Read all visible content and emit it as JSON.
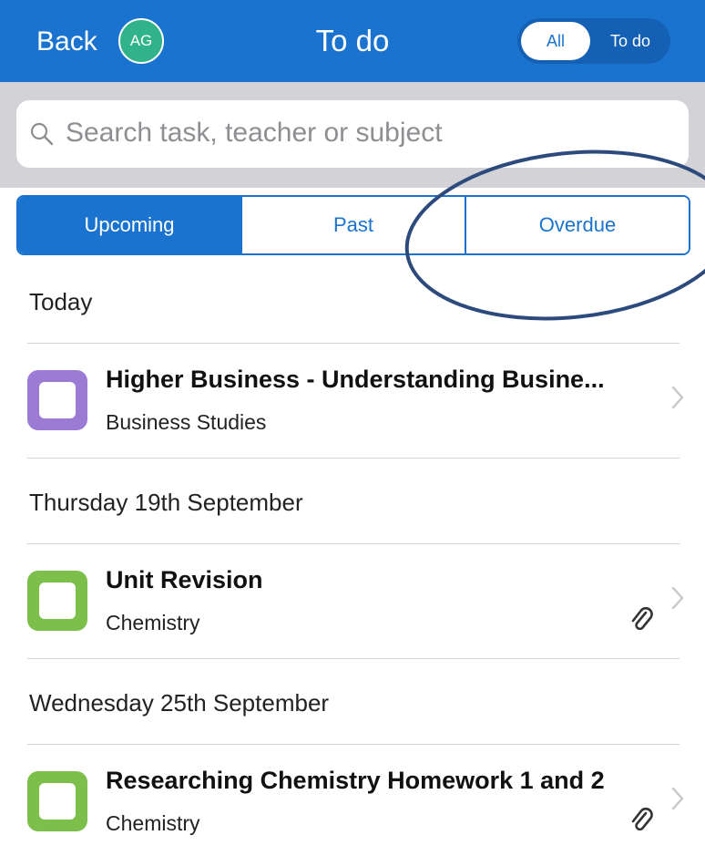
{
  "header": {
    "back_label": "Back",
    "avatar_initials": "AG",
    "title": "To do",
    "toggle": {
      "options": [
        "All",
        "To do"
      ],
      "selected": "All"
    }
  },
  "search": {
    "placeholder": "Search task, teacher or subject"
  },
  "filter_tabs": {
    "options": [
      "Upcoming",
      "Past",
      "Overdue"
    ],
    "selected": "Upcoming"
  },
  "sections": [
    {
      "header": "Today",
      "tasks": [
        {
          "title": "Higher Business - Understanding Busine...",
          "subject": "Business Studies",
          "color": "#9b7bd4",
          "has_attachment": false
        }
      ]
    },
    {
      "header": "Thursday 19th September",
      "tasks": [
        {
          "title": "Unit Revision",
          "subject": "Chemistry",
          "color": "#7cbf4a",
          "has_attachment": true
        }
      ]
    },
    {
      "header": "Wednesday 25th September",
      "tasks": [
        {
          "title": "Researching Chemistry Homework 1 and 2",
          "subject": "Chemistry",
          "color": "#7cbf4a",
          "has_attachment": true
        }
      ]
    }
  ],
  "colors": {
    "brand": "#1a74cf",
    "annotation": "#2c4a7c"
  },
  "icons": [
    "search-icon",
    "chevron-right-icon",
    "paperclip-icon"
  ]
}
